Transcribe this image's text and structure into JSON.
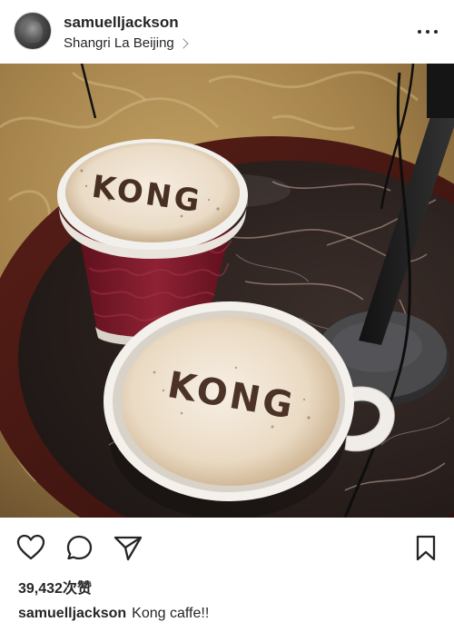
{
  "post": {
    "username": "samuelljackson",
    "location": "Shangri La Beijing",
    "likes": "39,432次赞",
    "caption_user": "samuelljackson",
    "caption_text": "Kong caffe!!",
    "latte_art_text": "KONG"
  },
  "icons": {
    "more": "more-options-icon",
    "like": "heart-icon",
    "comment": "comment-icon",
    "share": "direct-share-icon",
    "save": "bookmark-icon"
  },
  "colors": {
    "text": "#262626",
    "secondary": "#8e8e8e",
    "cup_red": "#7a1a2a",
    "foam": "#efe3d3",
    "cocoa": "#3a1f14",
    "marble": "#2a2220",
    "carpet": "#a98a52"
  }
}
